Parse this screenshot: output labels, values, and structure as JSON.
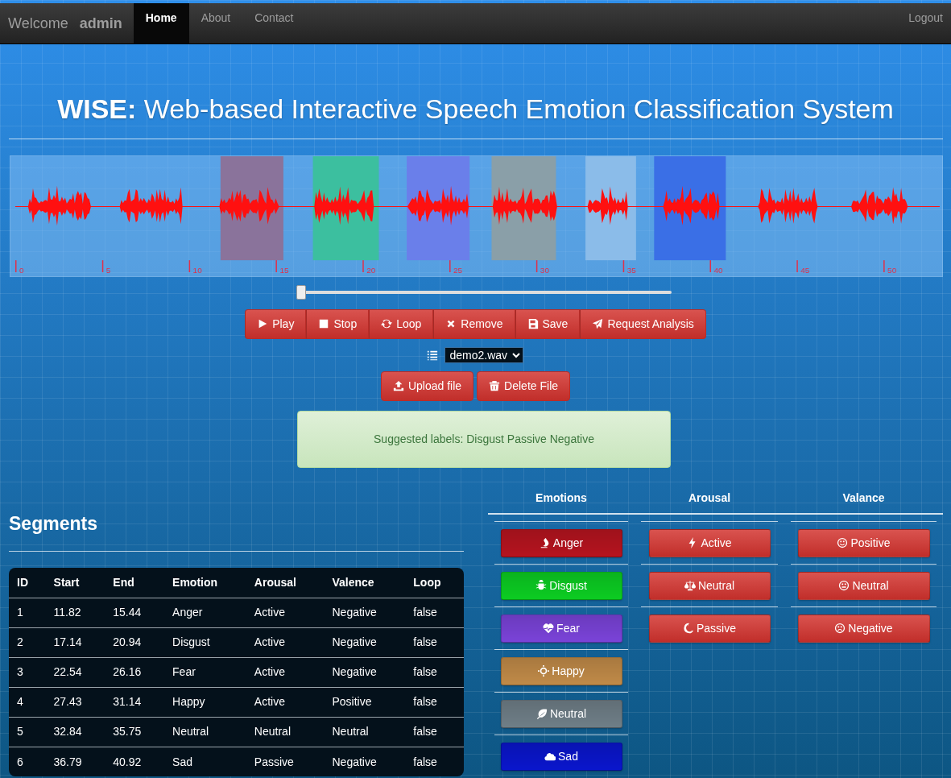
{
  "navbar": {
    "welcome": "Welcome",
    "user": "admin",
    "links": [
      {
        "label": "Home",
        "selected": true
      },
      {
        "label": "About",
        "selected": false
      },
      {
        "label": "Contact",
        "selected": false
      }
    ],
    "logout": "Logout"
  },
  "title": "**WISE:** Web-based Interactive Speech Emotion Classification System",
  "waveform": {
    "ticks": [
      "0",
      "5",
      "10",
      "15",
      "20",
      "25",
      "30",
      "35",
      "40",
      "45",
      "50"
    ],
    "regions": [
      {
        "color": "#8a739b"
      },
      {
        "color": "#3cbf9f"
      },
      {
        "color": "#6a7fea"
      },
      {
        "color": "#8a9fa8"
      },
      {
        "color": "#8bbce9"
      },
      {
        "color": "#3a6fe6"
      }
    ]
  },
  "seek": {
    "level": 0
  },
  "controls": [
    "Play",
    "Stop",
    "Loop",
    "Remove",
    "Save",
    "Request Analysis"
  ],
  "file": {
    "value": "demo2.wav"
  },
  "file_buttons": [
    "Upload file",
    "Delete File"
  ],
  "suggestion": "Suggested labels: Disgust Passive Negative",
  "segments": {
    "title": "Segments",
    "columns": [
      "ID",
      "Start",
      "End",
      "Emotion",
      "Arousal",
      "Valence",
      "Loop"
    ],
    "rows": [
      [
        "1",
        "11.82",
        "15.44",
        "Anger",
        "Active",
        "Negative",
        "false"
      ],
      [
        "2",
        "17.14",
        "20.94",
        "Disgust",
        "Active",
        "Negative",
        "false"
      ],
      [
        "3",
        "22.54",
        "26.16",
        "Fear",
        "Active",
        "Negative",
        "false"
      ],
      [
        "4",
        "27.43",
        "31.14",
        "Happy",
        "Active",
        "Positive",
        "false"
      ],
      [
        "5",
        "32.84",
        "35.75",
        "Neutral",
        "Neutral",
        "Neutral",
        "false"
      ],
      [
        "6",
        "36.79",
        "40.92",
        "Sad",
        "Passive",
        "Negative",
        "false"
      ]
    ]
  },
  "labels": [
    {
      "title": "Emotions",
      "items": [
        {
          "label": "Anger",
          "color": "#b5141f"
        },
        {
          "label": "Disgust",
          "color": "#0ccc22"
        },
        {
          "label": "Fear",
          "color": "#7a43d8"
        },
        {
          "label": "Happy",
          "color": "#c08a48"
        },
        {
          "label": "Neutral",
          "color": "#6f7e87"
        },
        {
          "label": "Sad",
          "color": "#0a16cc"
        }
      ]
    },
    {
      "title": "Arousal",
      "items": [
        {
          "label": "Active"
        },
        {
          "label": "Neutral"
        },
        {
          "label": "Passive"
        }
      ]
    },
    {
      "title": "Valance",
      "items": [
        {
          "label": "Positive"
        },
        {
          "label": "Neutral"
        },
        {
          "label": "Negative"
        }
      ]
    }
  ]
}
